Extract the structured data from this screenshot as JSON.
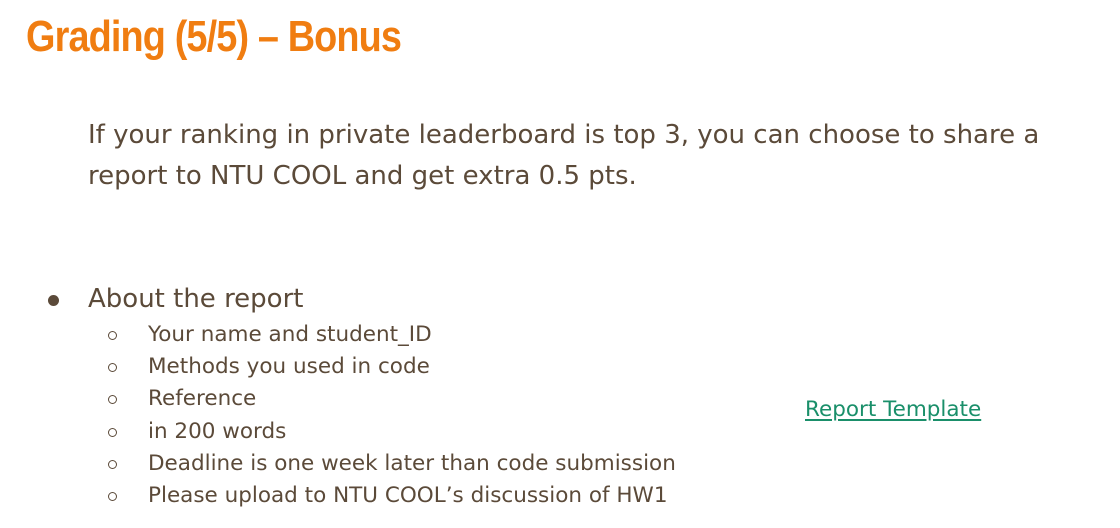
{
  "slide": {
    "title": "Grading (5/5) – Bonus",
    "bullets": [
      {
        "lines": [
          "If your ranking in private leaderboard is top 3, you can choose to share a",
          "report to NTU COOL and get extra 0.5 pts."
        ]
      },
      {
        "text": "About the report",
        "sub_items": [
          "Your name and student_ID",
          "Methods you used in code",
          "Reference",
          "in 200 words",
          "Deadline is one week later than code submission",
          "Please upload to NTU COOL’s discussion of HW1"
        ]
      }
    ],
    "link": {
      "label": "Report Template"
    }
  },
  "colors": {
    "title": "#f07d11",
    "body_text": "#5b4a39",
    "link": "#1a8f6a",
    "background": "#ffffff"
  },
  "icons": {
    "primary_bullet": "filled-circle-icon",
    "secondary_bullet": "hollow-circle-icon"
  }
}
